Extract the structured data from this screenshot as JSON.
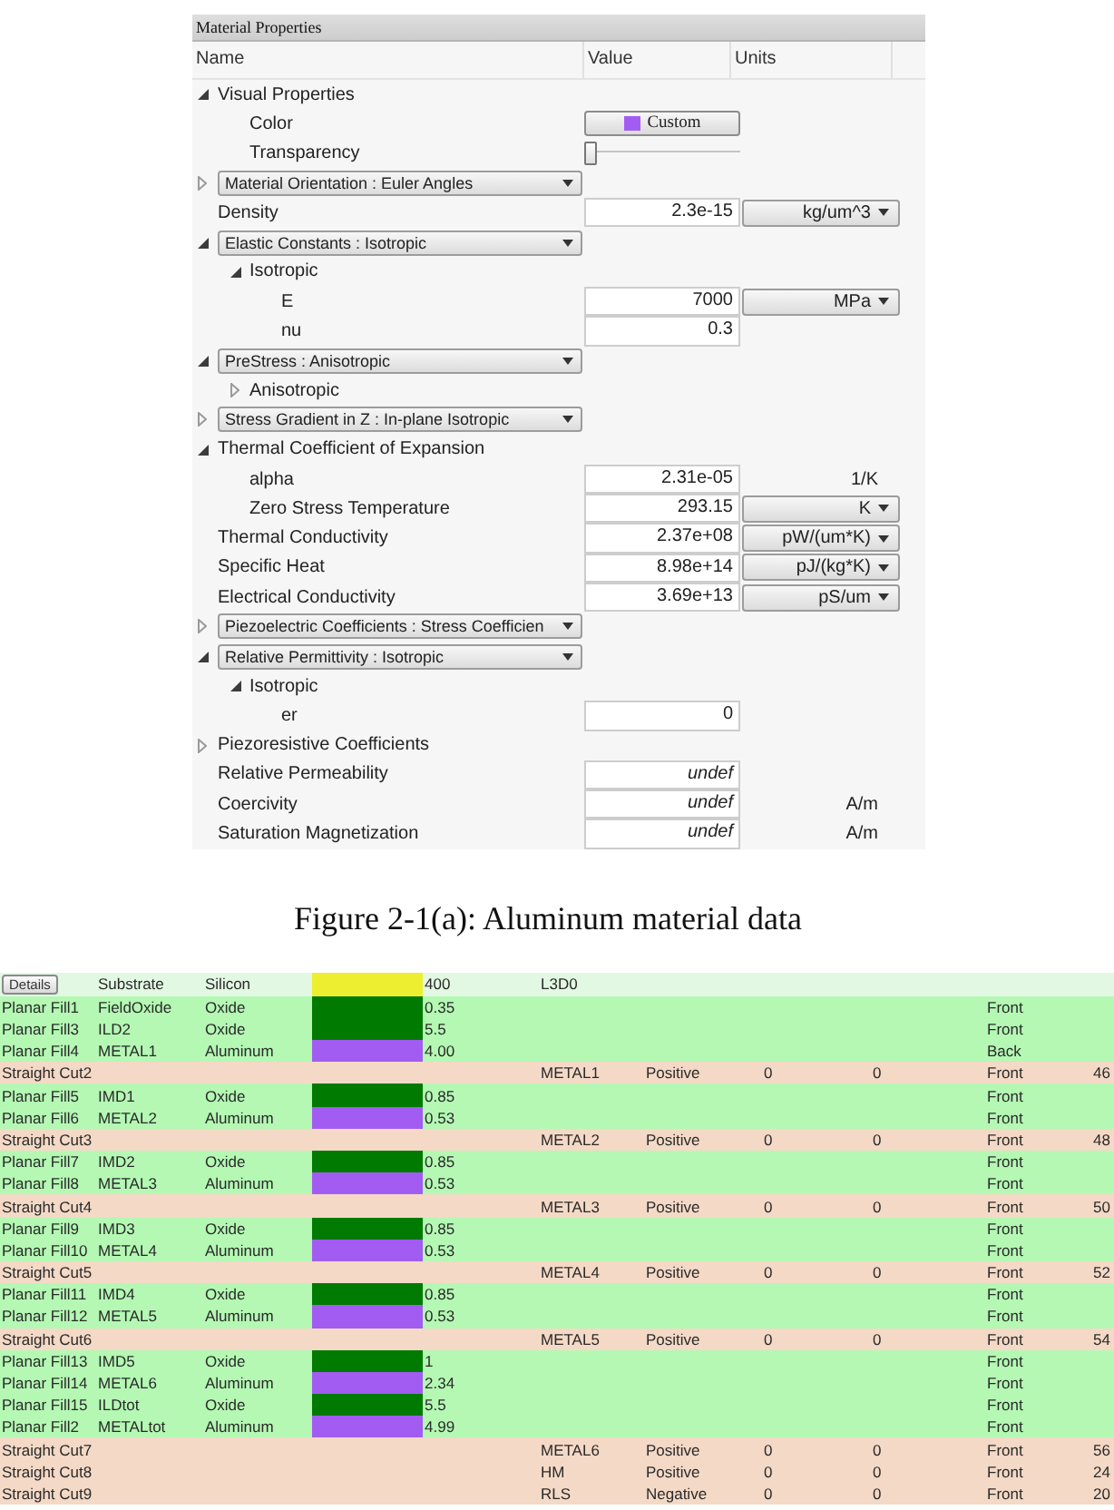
{
  "panel": {
    "title": "Material Properties",
    "columns": [
      "Name",
      "Value",
      "Units"
    ],
    "rows": [
      {
        "kind": "group",
        "label": "Visual Properties",
        "expanded": true,
        "children": [
          {
            "kind": "color",
            "label": "Color",
            "button": "Custom",
            "color": "#a35cf2"
          },
          {
            "kind": "slider",
            "label": "Transparency",
            "level": 0
          }
        ]
      },
      {
        "kind": "dropdown",
        "label": "Material Orientation : Euler Angles",
        "expanded": false
      },
      {
        "kind": "property",
        "label": "Density",
        "value": "2.3e-15",
        "defined": true,
        "unit": {
          "kind": "dropdown",
          "label": "kg/um^3"
        }
      },
      {
        "kind": "dropdown",
        "label": "Elastic Constants : Isotropic",
        "expanded": true,
        "children": [
          {
            "kind": "group",
            "label": "Isotropic",
            "expanded": true,
            "children": [
              {
                "kind": "property",
                "label": "E",
                "value": "7000",
                "defined": true,
                "unit": {
                  "kind": "dropdown",
                  "label": "MPa"
                }
              },
              {
                "kind": "property",
                "label": "nu",
                "value": "0.3",
                "defined": true
              }
            ]
          }
        ]
      },
      {
        "kind": "dropdown",
        "label": "PreStress : Anisotropic",
        "expanded": true,
        "children": [
          {
            "kind": "group",
            "label": "Anisotropic",
            "expanded": false
          }
        ]
      },
      {
        "kind": "dropdown",
        "label": "Stress Gradient in Z : In-plane Isotropic",
        "expanded": false
      },
      {
        "kind": "group",
        "label": "Thermal Coefficient of Expansion",
        "expanded": true,
        "children": [
          {
            "kind": "property",
            "label": "alpha",
            "value": "2.31e-05",
            "defined": true,
            "unit": {
              "kind": "text",
              "label": "1/K"
            }
          },
          {
            "kind": "property",
            "label": "Zero Stress Temperature",
            "value": "293.15",
            "defined": true,
            "unit": {
              "kind": "dropdown",
              "label": "K"
            }
          }
        ]
      },
      {
        "kind": "property",
        "label": "Thermal Conductivity",
        "value": "2.37e+08",
        "defined": true,
        "unit": {
          "kind": "dropdown",
          "label": "pW/(um*K)"
        }
      },
      {
        "kind": "property",
        "label": "Specific Heat",
        "value": "8.98e+14",
        "defined": true,
        "unit": {
          "kind": "dropdown",
          "label": "pJ/(kg*K)"
        }
      },
      {
        "kind": "property",
        "label": "Electrical Conductivity",
        "value": "3.69e+13",
        "defined": true,
        "unit": {
          "kind": "dropdown",
          "label": "pS/um"
        }
      },
      {
        "kind": "dropdown",
        "label": "Piezoelectric Coefficients : Stress Coefficien",
        "expanded": false
      },
      {
        "kind": "dropdown",
        "label": "Relative Permittivity : Isotropic",
        "expanded": true,
        "children": [
          {
            "kind": "group",
            "label": "Isotropic",
            "expanded": true,
            "children": [
              {
                "kind": "property",
                "label": "er",
                "value": "0",
                "defined": true
              }
            ]
          }
        ]
      },
      {
        "kind": "group",
        "label": "Piezoresistive Coefficients",
        "expanded": false
      },
      {
        "kind": "property",
        "label": "Relative Permeability",
        "value": "undef",
        "defined": false
      },
      {
        "kind": "property",
        "label": "Coercivity",
        "value": "undef",
        "defined": false,
        "unit": {
          "kind": "text",
          "label": "A/m"
        }
      },
      {
        "kind": "property",
        "label": "Saturation Magnetization",
        "value": "undef",
        "defined": false,
        "unit": {
          "kind": "text",
          "label": "A/m"
        }
      }
    ]
  },
  "caption": "Figure 2-1(a): Aluminum material data",
  "table": {
    "rows": [
      {
        "kind": "substrate",
        "selected": true,
        "button": "Details",
        "column_2": "Substrate",
        "column_3": "Silicon",
        "color": "#eeee30",
        "column_5": "400",
        "column_6": "L3D0"
      },
      {
        "kind": "fill",
        "selected": false,
        "column_1": "Planar Fill1",
        "column_2": "FieldOxide",
        "column_3": "Oxide",
        "color": "#007a00",
        "column_5": "0.35",
        "column_10": "Front"
      },
      {
        "kind": "fill",
        "selected": false,
        "column_1": "Planar Fill3",
        "column_2": "ILD2",
        "column_3": "Oxide",
        "color": "#007a00",
        "column_5": "5.5",
        "column_10": "Front"
      },
      {
        "kind": "fill",
        "selected": false,
        "column_1": "Planar Fill4",
        "column_2": "METAL1",
        "column_3": "Aluminum",
        "color": "#a35cf2",
        "column_5": "4.00",
        "column_10": "Back"
      },
      {
        "kind": "cut",
        "selected": false,
        "column_1": "Straight Cut2",
        "column_6": "METAL1",
        "column_7": "Positive",
        "column_8": "0",
        "column_9": "0",
        "column_10": "Front",
        "column_11": "46"
      },
      {
        "kind": "fill",
        "selected": false,
        "column_1": "Planar Fill5",
        "column_2": "IMD1",
        "column_3": "Oxide",
        "color": "#007a00",
        "column_5": "0.85",
        "column_10": "Front"
      },
      {
        "kind": "fill",
        "selected": false,
        "column_1": "Planar Fill6",
        "column_2": "METAL2",
        "column_3": "Aluminum",
        "color": "#a35cf2",
        "column_5": "0.53",
        "column_10": "Front"
      },
      {
        "kind": "cut",
        "selected": false,
        "column_1": "Straight Cut3",
        "column_6": "METAL2",
        "column_7": "Positive",
        "column_8": "0",
        "column_9": "0",
        "column_10": "Front",
        "column_11": "48"
      },
      {
        "kind": "fill",
        "selected": false,
        "column_1": "Planar Fill7",
        "column_2": "IMD2",
        "column_3": "Oxide",
        "color": "#007a00",
        "column_5": "0.85",
        "column_10": "Front"
      },
      {
        "kind": "fill",
        "selected": false,
        "column_1": "Planar Fill8",
        "column_2": "METAL3",
        "column_3": "Aluminum",
        "color": "#a35cf2",
        "column_5": "0.53",
        "column_10": "Front"
      },
      {
        "kind": "cut",
        "selected": false,
        "column_1": "Straight Cut4",
        "column_6": "METAL3",
        "column_7": "Positive",
        "column_8": "0",
        "column_9": "0",
        "column_10": "Front",
        "column_11": "50"
      },
      {
        "kind": "fill",
        "selected": false,
        "column_1": "Planar Fill9",
        "column_2": "IMD3",
        "column_3": "Oxide",
        "color": "#007a00",
        "column_5": "0.85",
        "column_10": "Front"
      },
      {
        "kind": "fill",
        "selected": false,
        "column_1": "Planar Fill10",
        "column_2": "METAL4",
        "column_3": "Aluminum",
        "color": "#a35cf2",
        "column_5": "0.53",
        "column_10": "Front"
      },
      {
        "kind": "cut",
        "selected": false,
        "column_1": "Straight Cut5",
        "column_6": "METAL4",
        "column_7": "Positive",
        "column_8": "0",
        "column_9": "0",
        "column_10": "Front",
        "column_11": "52"
      },
      {
        "kind": "fill",
        "selected": false,
        "column_1": "Planar Fill11",
        "column_2": "IMD4",
        "column_3": "Oxide",
        "color": "#007a00",
        "column_5": "0.85",
        "column_10": "Front"
      },
      {
        "kind": "fill",
        "selected": false,
        "column_1": "Planar Fill12",
        "column_2": "METAL5",
        "column_3": "Aluminum",
        "color": "#a35cf2",
        "column_5": "0.53",
        "column_10": "Front"
      },
      {
        "kind": "cut",
        "selected": false,
        "column_1": "Straight Cut6",
        "column_6": "METAL5",
        "column_7": "Positive",
        "column_8": "0",
        "column_9": "0",
        "column_10": "Front",
        "column_11": "54"
      },
      {
        "kind": "fill",
        "selected": false,
        "column_1": "Planar Fill13",
        "column_2": "IMD5",
        "column_3": "Oxide",
        "color": "#007a00",
        "column_5": "1",
        "column_10": "Front"
      },
      {
        "kind": "fill",
        "selected": false,
        "column_1": "Planar Fill14",
        "column_2": "METAL6",
        "column_3": "Aluminum",
        "color": "#a35cf2",
        "column_5": "2.34",
        "column_10": "Front"
      },
      {
        "kind": "fill",
        "selected": false,
        "column_1": "Planar Fill15",
        "column_2": "ILDtot",
        "column_3": "Oxide",
        "color": "#007a00",
        "column_5": "5.5",
        "column_10": "Front"
      },
      {
        "kind": "fill",
        "selected": false,
        "column_1": "Planar Fill2",
        "column_2": "METALtot",
        "column_3": "Aluminum",
        "color": "#a35cf2",
        "column_5": "4.99",
        "column_10": "Front"
      },
      {
        "kind": "cut",
        "selected": false,
        "column_1": "Straight Cut7",
        "column_6": "METAL6",
        "column_7": "Positive",
        "column_8": "0",
        "column_9": "0",
        "column_10": "Front",
        "column_11": "56"
      },
      {
        "kind": "cut",
        "selected": false,
        "column_1": "Straight Cut8",
        "column_6": "HM",
        "column_7": "Positive",
        "column_8": "0",
        "column_9": "0",
        "column_10": "Front",
        "column_11": "24"
      },
      {
        "kind": "cut",
        "selected": false,
        "column_1": "Straight Cut9",
        "column_6": "RLS",
        "column_7": "Negative",
        "column_8": "0",
        "column_9": "0",
        "column_10": "Front",
        "column_11": "20"
      }
    ]
  }
}
